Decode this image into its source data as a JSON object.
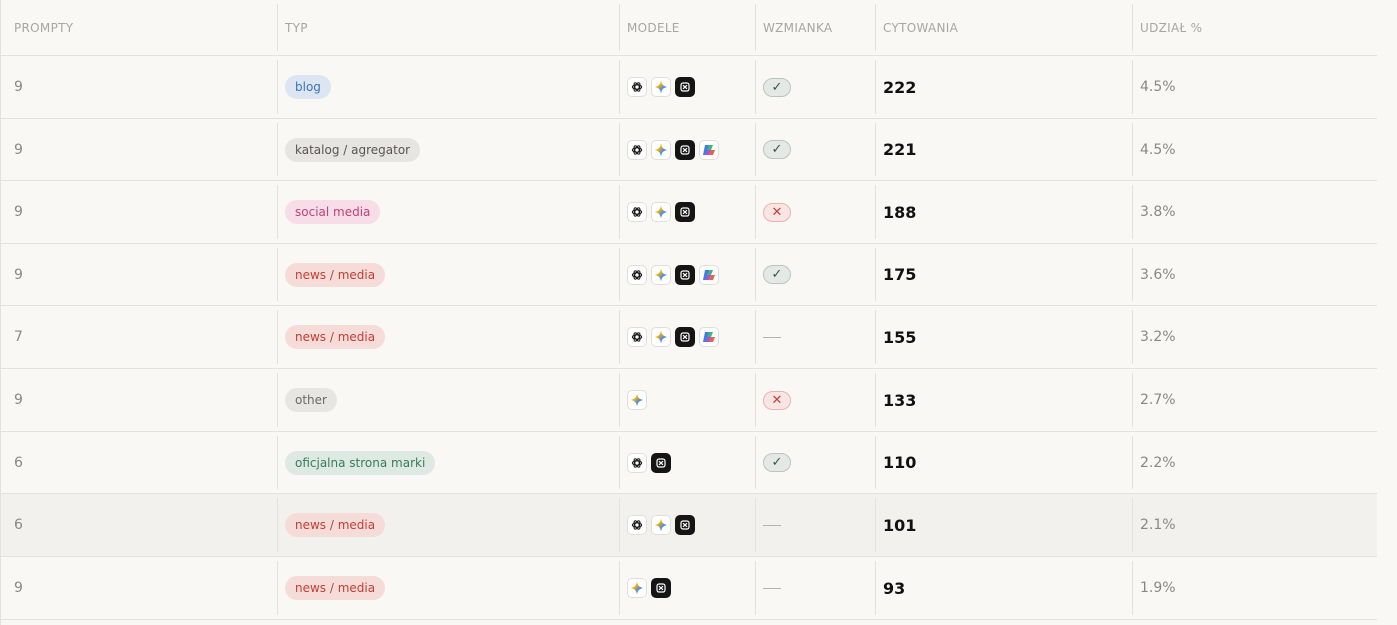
{
  "headers": {
    "prompty": "PROMPTY",
    "typ": "TYP",
    "modele": "MODELE",
    "wzmianka": "WZMIANKA",
    "cytowania": "CYTOWANIA",
    "udzial": "UDZIAŁ %"
  },
  "type_colors": {
    "blog": {
      "bg": "#dce6f3",
      "fg": "#3a73b8"
    },
    "catalog": {
      "bg": "#e7e5e1",
      "fg": "#58564f"
    },
    "social": {
      "bg": "#f6dde8",
      "fg": "#c2407a"
    },
    "news": {
      "bg": "#f6dcd8",
      "fg": "#c23d36"
    },
    "other": {
      "bg": "#e8e6e2",
      "fg": "#6b6963"
    },
    "official": {
      "bg": "#dde9e2",
      "fg": "#3a7b58"
    }
  },
  "rows": [
    {
      "prompty": "9",
      "typ": "blog",
      "kind": "blog",
      "models": [
        "gpt",
        "gem",
        "grk"
      ],
      "mention": "yes",
      "cytowania": "222",
      "udzial": "4.5%"
    },
    {
      "prompty": "9",
      "typ": "katalog / agregator",
      "kind": "catalog",
      "models": [
        "gpt",
        "gem",
        "grk",
        "cop"
      ],
      "mention": "yes",
      "cytowania": "221",
      "udzial": "4.5%"
    },
    {
      "prompty": "9",
      "typ": "social media",
      "kind": "social",
      "models": [
        "gpt",
        "gem",
        "grk"
      ],
      "mention": "no",
      "cytowania": "188",
      "udzial": "3.8%"
    },
    {
      "prompty": "9",
      "typ": "news / media",
      "kind": "news",
      "models": [
        "gpt",
        "gem",
        "grk",
        "cop"
      ],
      "mention": "yes",
      "cytowania": "175",
      "udzial": "3.6%"
    },
    {
      "prompty": "7",
      "typ": "news / media",
      "kind": "news",
      "models": [
        "gpt",
        "gem",
        "grk",
        "cop"
      ],
      "mention": "none",
      "cytowania": "155",
      "udzial": "3.2%"
    },
    {
      "prompty": "9",
      "typ": "other",
      "kind": "other",
      "models": [
        "gem"
      ],
      "mention": "no",
      "cytowania": "133",
      "udzial": "2.7%"
    },
    {
      "prompty": "6",
      "typ": "oficjalna strona marki",
      "kind": "official",
      "models": [
        "gpt",
        "grk"
      ],
      "mention": "yes",
      "cytowania": "110",
      "udzial": "2.2%"
    },
    {
      "prompty": "6",
      "typ": "news / media",
      "kind": "news",
      "models": [
        "gpt",
        "gem",
        "grk"
      ],
      "mention": "none",
      "cytowania": "101",
      "udzial": "2.1%",
      "hovered": true
    },
    {
      "prompty": "9",
      "typ": "news / media",
      "kind": "news",
      "models": [
        "gem",
        "grk"
      ],
      "mention": "none",
      "cytowania": "93",
      "udzial": "1.9%"
    }
  ]
}
